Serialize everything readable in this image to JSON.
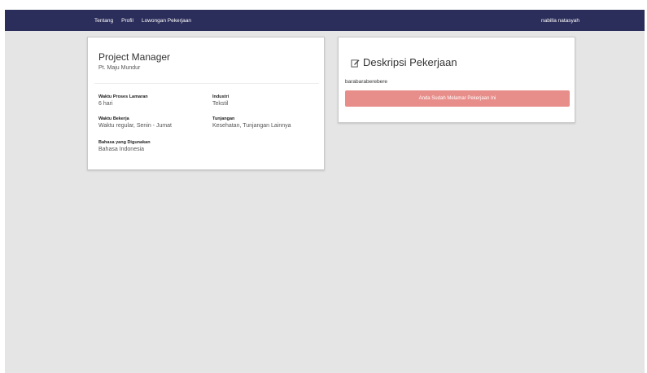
{
  "navbar": {
    "links": [
      "Tentang",
      "Profil",
      "Lowongan Pekerjaan"
    ],
    "user": "nabilla natasyah"
  },
  "job": {
    "title": "Project Manager",
    "company": "Pt. Maju Mundur",
    "fields": [
      {
        "label": "Waktu Proses Lamaran",
        "value": "6 hari"
      },
      {
        "label": "Industri",
        "value": "Tekstil"
      },
      {
        "label": "Waktu Bekerja",
        "value": "Waktu regular, Senin - Jumat"
      },
      {
        "label": "Tunjangan",
        "value": "Kesehatan, Tunjangan Lainnya"
      },
      {
        "label": "Bahasa yang Digunakan",
        "value": "Bahasa Indonesia"
      }
    ]
  },
  "description": {
    "heading": "Deskripsi Pekerjaan",
    "icon": "edit-icon",
    "text": "barabaraberebere",
    "button_label": "Anda Sudah Melamar Pekerjaan Ini",
    "button_color": "#e88e8a"
  },
  "colors": {
    "navbar": "#2b2d5a",
    "background": "#e5e5e5"
  }
}
